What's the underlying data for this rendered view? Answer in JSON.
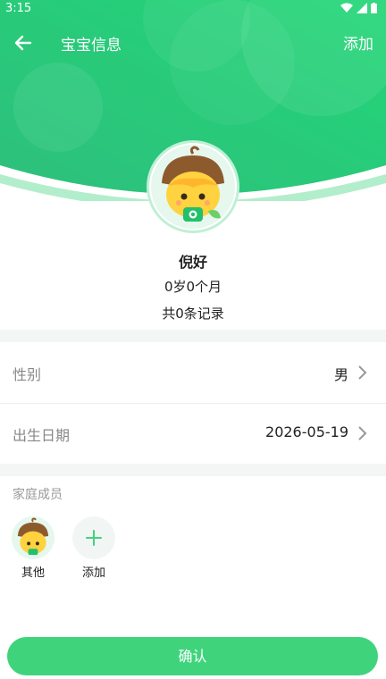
{
  "status_bar": {
    "time": "3:15"
  },
  "topbar": {
    "title": "宝宝信息",
    "add_label": "添加"
  },
  "profile": {
    "name": "倪好",
    "age": "0岁0个月",
    "records": "共0条记录"
  },
  "rows": [
    {
      "label": "性别",
      "value": "男"
    },
    {
      "label": "出生日期",
      "value": "2026-05-19"
    }
  ],
  "family": {
    "title": "家庭成员",
    "members": [
      {
        "label": "其他"
      }
    ],
    "add_label": "添加"
  },
  "confirm_label": "确认",
  "colors": {
    "accent": "#3fd47c",
    "header_dark": "#2ec27e",
    "header_light": "#4fe08a"
  }
}
